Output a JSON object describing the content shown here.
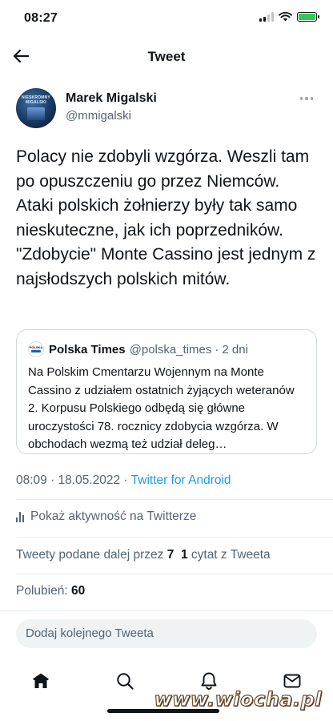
{
  "status_bar": {
    "time": "08:27"
  },
  "nav": {
    "title": "Tweet"
  },
  "author": {
    "name": "Marek Migalski",
    "handle": "@mmigalski",
    "avatar_text": "NIESKROMNY MIGALSKI"
  },
  "tweet": {
    "text": "Polacy nie zdobyli wzgórza. Weszli tam po opuszczeniu go przez Niemców. Ataki polskich żołnierzy były tak samo nieskuteczne, jak ich poprzedników. \"Zdobycie\" Monte Cassino jest jednym z najsłodszych polskich mitów."
  },
  "quote": {
    "logo_text": "POLSKA",
    "name": "Polska Times",
    "handle": "@polska_times",
    "separator": "·",
    "time": "2 dni",
    "text": "Na Polskim Cmentarzu Wojennym na Monte Cassino z udziałem ostatnich żyjących weteranów 2. Korpusu Polskiego odbędą się główne uroczystości 78. rocznicy zdobycia wzgórza. W obchodach wezmą też udział deleg…"
  },
  "meta": {
    "datetime": "08:09 · 18.05.2022 · ",
    "source": "Twitter for Android"
  },
  "analytics": {
    "label": "Pokaż aktywność na Twitterze"
  },
  "stats": {
    "retweets_label": "Tweety podane dalej przez ",
    "retweets_count": "7",
    "quotes_count": "1",
    "quotes_label": " cytat z Tweeta",
    "likes_label": "Polubień: ",
    "likes_count": "60"
  },
  "reply": {
    "placeholder": "Dodaj kolejnego Tweeta"
  },
  "tabbar": {
    "icons": [
      "home-icon",
      "search-icon",
      "notifications-icon",
      "messages-icon"
    ]
  },
  "watermark": {
    "text": "www.wiocha.pl"
  },
  "colors": {
    "accent": "#1d9bf0",
    "text": "#0f1419",
    "secondary": "#536471",
    "border": "#cfd9de"
  }
}
